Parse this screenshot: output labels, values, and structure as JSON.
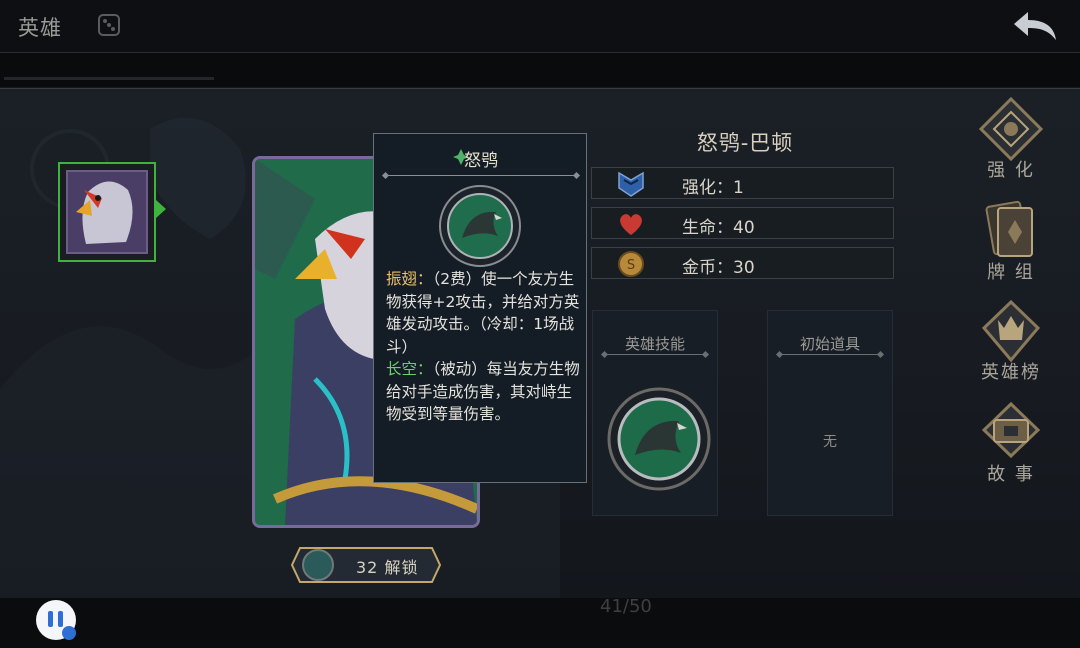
{
  "header": {
    "title": "英雄",
    "back_icon": "back-arrow-icon",
    "dice_icon": "dice-icon"
  },
  "hero": {
    "name": "怒鸮-巴顿",
    "stats": [
      {
        "icon": "badge-icon",
        "label": "强化：1"
      },
      {
        "icon": "heart-icon",
        "label": "生命：40"
      },
      {
        "icon": "coin-icon",
        "label": "金币：30"
      }
    ],
    "panels": {
      "skill_title": "英雄技能",
      "item_title": "初始道具",
      "item_value": "无"
    }
  },
  "tooltip": {
    "title": "怒鸮",
    "skill1_name": "振翅：",
    "skill1_text": "（2费）使一个友方生物获得+2攻击，并给对方英雄发动攻击。（冷却：1场战斗）",
    "skill2_name": "长空：",
    "skill2_text": "（被动）每当友方生物给对手造成伤害，其对峙生物受到等量伤害。"
  },
  "unlock": {
    "label": "32 解锁"
  },
  "side_menu": [
    {
      "label": "强 化",
      "icon": "enhance-icon"
    },
    {
      "label": "牌 组",
      "icon": "card-deck-icon"
    },
    {
      "label": "英雄榜",
      "icon": "hero-ranking-icon"
    },
    {
      "label": "故 事",
      "icon": "story-icon"
    }
  ],
  "footer": {
    "page_counter": "41/50"
  },
  "colors": {
    "selected_border": "#3fb33d",
    "keyword_gold": "#e7c06c",
    "keyword_green": "#6ed06b"
  }
}
